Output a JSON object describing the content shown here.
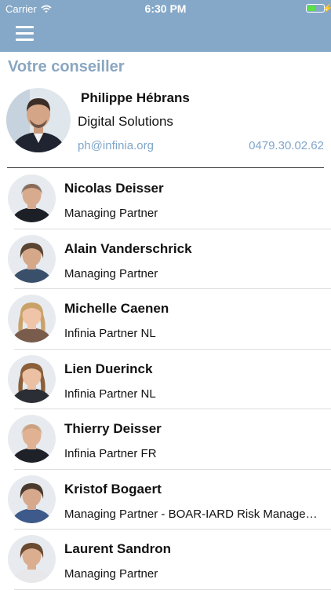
{
  "status_bar": {
    "carrier": "Carrier",
    "time": "6:30 PM",
    "battery_level": 0.45,
    "wifi_icon": "wifi-icon",
    "battery_icon": "battery-icon"
  },
  "nav": {
    "menu_icon": "hamburger-menu-icon"
  },
  "section_title": "Votre conseiller",
  "advisor": {
    "name": "Philippe Hébrans",
    "department": "Digital Solutions",
    "email": "ph@infinia.org",
    "phone": "0479.30.02.62"
  },
  "contacts": [
    {
      "name": "Nicolas Deisser",
      "role": "Managing Partner",
      "skin": "#d9ab8e",
      "hair": "#3a2a22",
      "shirt": "#1c1f25",
      "bald": true
    },
    {
      "name": "Alain Vanderschrick",
      "role": "Managing Partner",
      "skin": "#d6a88a",
      "hair": "#5a4535",
      "shirt": "#3a4f6a",
      "bald": false
    },
    {
      "name": "Michelle Caenen",
      "role": "Infinia Partner NL",
      "skin": "#efc4a8",
      "hair": "#c9a26a",
      "shirt": "#7a5c4c",
      "bald": false
    },
    {
      "name": "Lien Duerinck",
      "role": "Infinia Partner NL",
      "skin": "#ecc1a3",
      "hair": "#8a5f3a",
      "shirt": "#2c2e35",
      "bald": false
    },
    {
      "name": "Thierry Deisser",
      "role": "Infinia Partner FR",
      "skin": "#e0b293",
      "hair": "#b88d6a",
      "shirt": "#1e2128",
      "bald": true
    },
    {
      "name": "Kristof Bogaert",
      "role": "Managing Partner - BOAR-IARD Risk Management",
      "skin": "#d7a98c",
      "hair": "#4a3a2e",
      "shirt": "#3d5a8a",
      "bald": false
    },
    {
      "name": "Laurent Sandron",
      "role": "Managing Partner",
      "skin": "#dcae90",
      "hair": "#6a4a30",
      "shirt": "#e8e8ea",
      "bald": false
    }
  ]
}
